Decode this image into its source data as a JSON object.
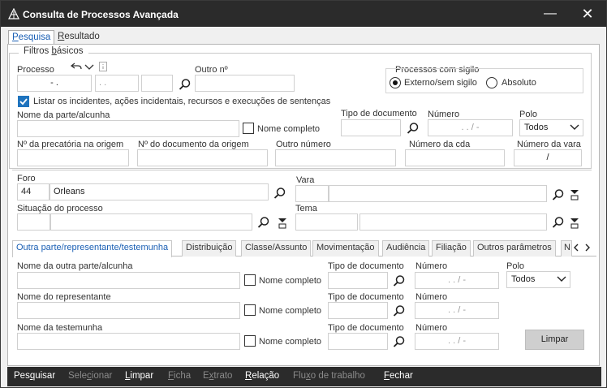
{
  "window": {
    "title": "Consulta de Processos Avançada",
    "minimize": "—",
    "close": "✕"
  },
  "tabs_top": [
    {
      "label_u": "P",
      "label_rest": "esquisa"
    },
    {
      "label_u": "R",
      "label_rest": "esultado"
    }
  ],
  "filtros": {
    "legend_pre": "Filtros ",
    "legend_u": "b",
    "legend_post": "ásicos",
    "processo_label": "Processo",
    "processo_value": "- .",
    "processo_part2": ". .",
    "outro_label": "Outro nº",
    "sigilo_label": "Processos com sigilo",
    "sigilo_options": [
      "Externo/sem sigilo",
      "Absoluto"
    ],
    "listar_label": "Listar os incidentes, ações incidentais, recursos e execuções de sentenças",
    "nome_parte_label": "Nome da parte/alcunha",
    "nome_completo_label": "Nome completo",
    "tipo_doc_label": "Tipo de documento",
    "numero_label": "Número",
    "numero_placeholder": ". . / -",
    "polo_label": "Polo",
    "polo_value": "Todos",
    "precatoria_label": "Nº da precatória na origem",
    "doc_origem_label": "Nº do documento da origem",
    "outro_numero_label": "Outro número",
    "numero_cda_label": "Número da cda",
    "numero_vara_label": "Número da vara",
    "numero_vara_value": "/"
  },
  "foro": {
    "label": "Foro",
    "code": "44",
    "name": "Orleans"
  },
  "vara": {
    "label": "Vara"
  },
  "situacao": {
    "label": "Situação do processo"
  },
  "tema": {
    "label": "Tema"
  },
  "tabs2": [
    {
      "label": "Outra parte/representante/testemunha",
      "u": "O"
    },
    {
      "label": "Distribuição",
      "u": "D"
    },
    {
      "label": "Classe/Assunto",
      "u": "s"
    },
    {
      "label": "Movimentação",
      "u": "M"
    },
    {
      "label": "Audiência",
      "u": "A"
    },
    {
      "label": "Filiação",
      "u": "ç"
    },
    {
      "label": "Outros parâmetros",
      "u": ""
    },
    {
      "label": "N",
      "u": ""
    }
  ],
  "outra_parte": {
    "nome_outra_label": "Nome da outra parte/alcunha",
    "nome_rep_label": "Nome do representante",
    "nome_test_label": "Nome da testemunha",
    "nome_completo_label": "Nome completo",
    "tipo_doc_label": "Tipo de documento",
    "numero_label": "Número",
    "numero_placeholder": ". . / -",
    "polo_label": "Polo",
    "polo_value": "Todos",
    "limpar": "Limpar"
  },
  "bottom_bar": [
    {
      "pre": "Pes",
      "u": "q",
      "post": "uisar",
      "enabled": true
    },
    {
      "pre": "Sele",
      "u": "c",
      "post": "ionar",
      "enabled": false
    },
    {
      "pre": "",
      "u": "L",
      "post": "impar",
      "enabled": true
    },
    {
      "pre": "",
      "u": "F",
      "post": "icha",
      "enabled": false
    },
    {
      "pre": "E",
      "u": "x",
      "post": "trato",
      "enabled": false
    },
    {
      "pre": "",
      "u": "R",
      "post": "elação",
      "enabled": true
    },
    {
      "pre": "Flu",
      "u": "x",
      "post": "o de trabalho",
      "enabled": false
    },
    {
      "pre": "",
      "u": "F",
      "post": "echar",
      "enabled": true
    }
  ],
  "colors": {
    "titlebar": "#2b2b2b",
    "accent": "#1e73be",
    "active_tab_text": "#1a5fb4"
  }
}
